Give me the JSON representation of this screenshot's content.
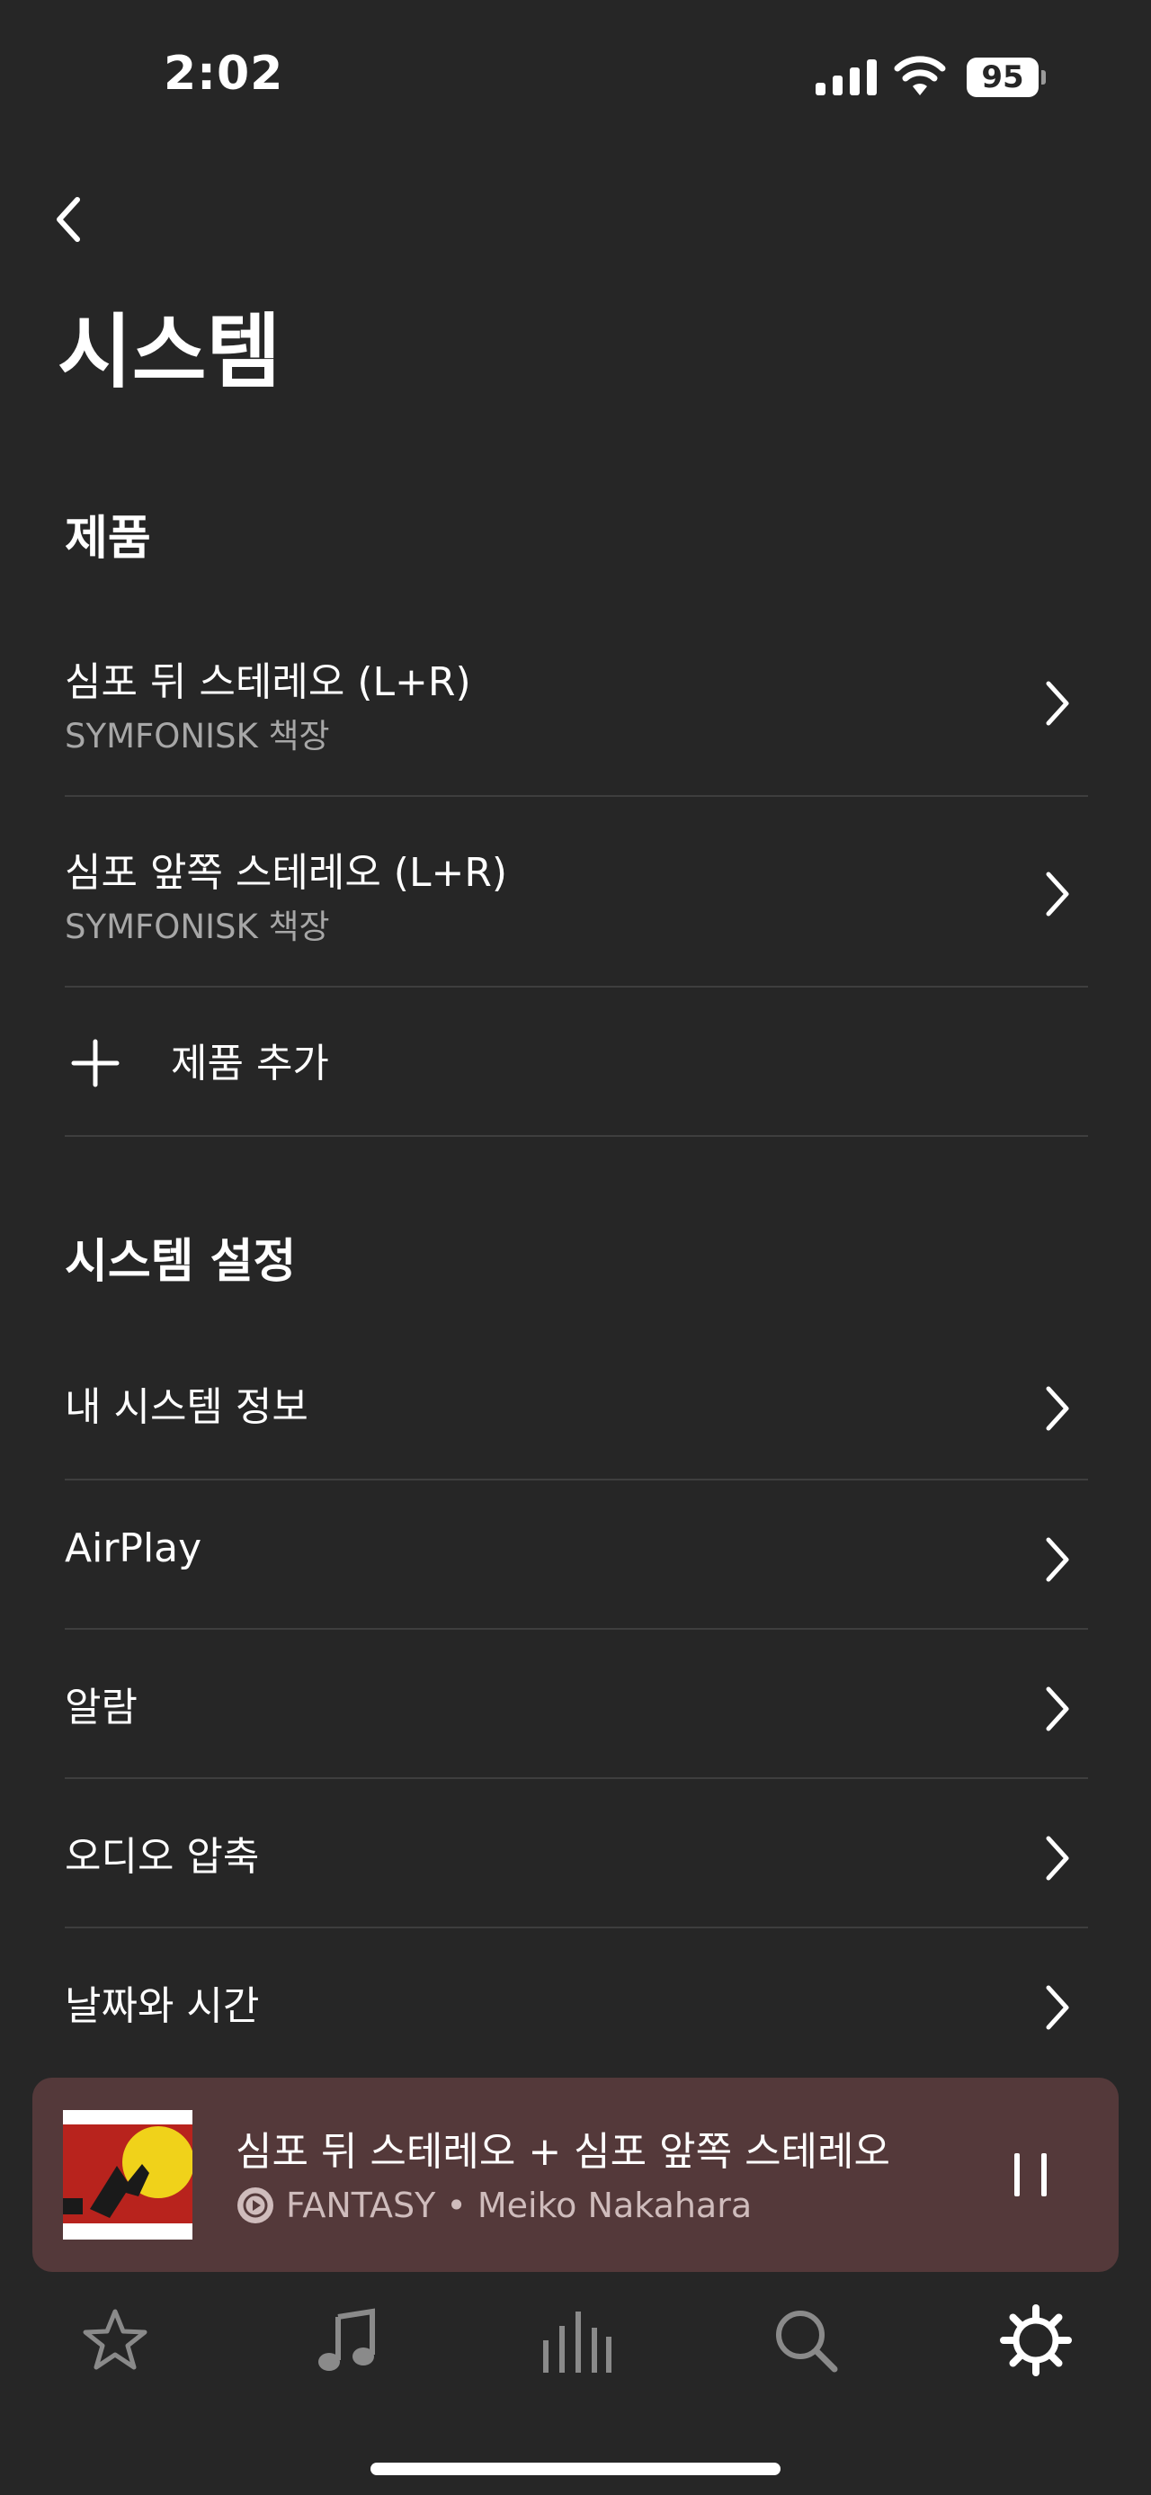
{
  "status_bar": {
    "time": "2:02",
    "battery": "95"
  },
  "page": {
    "title": "시스템"
  },
  "products_section": {
    "header": "제품",
    "items": [
      {
        "title": "심포 뒤 스테레오 (L+R)",
        "subtitle": "SYMFONISK 책장"
      },
      {
        "title": "심포 앞쪽 스테레오 (L+R)",
        "subtitle": "SYMFONISK 책장"
      }
    ],
    "add_label": "제품 추가"
  },
  "settings_section": {
    "header": "시스템 설정",
    "items": [
      {
        "label": "내 시스템 정보"
      },
      {
        "label": "AirPlay"
      },
      {
        "label": "알람"
      },
      {
        "label": "오디오 압축"
      },
      {
        "label": "날짜와 시간"
      }
    ]
  },
  "now_playing": {
    "title": "심포 뒤 스테레오 + 심포 앞쪽 스테레오",
    "track": "FANTASY",
    "separator": "•",
    "artist": "Meiko Nakahara",
    "background_color": "#54393a"
  },
  "tab_bar": {
    "tabs": [
      {
        "icon": "star-icon",
        "active": false
      },
      {
        "icon": "music-note-icon",
        "active": false
      },
      {
        "icon": "rooms-bars-icon",
        "active": false
      },
      {
        "icon": "search-icon",
        "active": false
      },
      {
        "icon": "gear-icon",
        "active": true
      }
    ]
  },
  "colors": {
    "background": "#262626",
    "divider": "#3e3e3e",
    "secondary_text": "#a7a7a7",
    "inactive_icon": "#8a8a8a"
  }
}
